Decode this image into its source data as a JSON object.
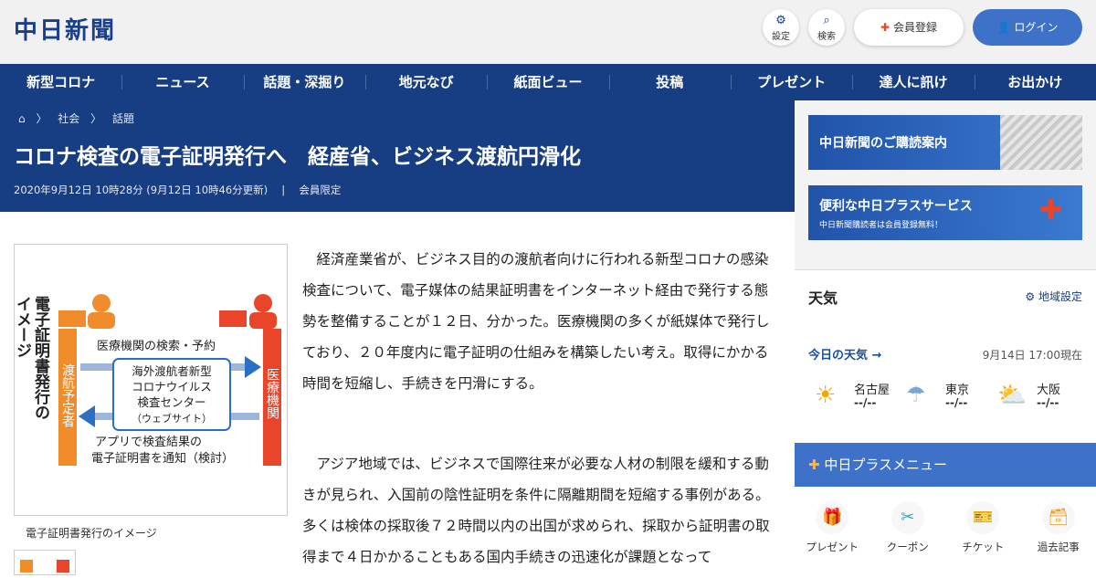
{
  "header": {
    "logo": "中日新聞",
    "settings_label": "設定",
    "search_label": "検索",
    "register_label": "会員登録",
    "login_label": "ログイン"
  },
  "nav": {
    "items": [
      "新型コロナ",
      "ニュース",
      "話題・深掘り",
      "地元なび",
      "紙面ビュー",
      "投稿",
      "プレゼント",
      "達人に訊け",
      "お出かけ"
    ]
  },
  "breadcrumb": {
    "items": [
      "社会",
      "話題"
    ]
  },
  "article": {
    "title": "コロナ検査の電子証明発行へ　経産省、ビジネス渡航円滑化",
    "date": "2020年9月12日 10時28分 (9月12日 10時46分更新)",
    "members_only": "会員限定",
    "caption": "電子証明書発行のイメージ",
    "paragraphs": [
      "経済産業省が、ビジネス目的の渡航者向けに行われる新型コロナの感染検査について、電子媒体の結果証明書をインターネット経由で発行する態勢を整備することが１２日、分かった。医療機関の多くが紙媒体で発行しており、２０年度内に電子証明の仕組みを構築したい考え。取得にかかる時間を短縮し、手続きを円滑にする。",
      "アジア地域では、ビジネスで国際往来が必要な人材の制限を緩和する動きが見られ、入国前の陰性証明を条件に隔離期間を短縮する事例がある。多くは検体の採取後７２時間以内の出国が求められ、採取から証明書の取得まで４日かかることもある国内手続きの迅速化が課題となって"
    ]
  },
  "figure": {
    "vertical_title": [
      "電子証明書発行の",
      "イメージ"
    ],
    "left_actor": "渡航予定者",
    "right_actor": "医療機関",
    "top_arrow_label": "医療機関の検索・予約",
    "center_box": [
      "海外渡航者新型",
      "コロナウイルス",
      "検査センター",
      "（ウェブサイト）"
    ],
    "bottom_label": [
      "アプリで検査結果の",
      "電子証明書を通知（検討）"
    ],
    "accent_orange": "#f08c2a",
    "accent_red": "#e8452a",
    "accent_blue": "#2a6fc4"
  },
  "sidebar": {
    "ad1": "中日新聞のご購読案内",
    "ad2_title": "便利な中日プラスサービス",
    "ad2_sub": "中日新聞購読者は会員登録無料！",
    "weather_title": "天気",
    "region_setting": "地域設定",
    "today_weather": "今日の天気",
    "updated": "9月14日 17:00現在",
    "cities": [
      {
        "name": "名古屋",
        "temp": "--/--",
        "icon": "sun-icon"
      },
      {
        "name": "東京",
        "temp": "--/--",
        "icon": "cloud-rain-icon"
      },
      {
        "name": "大阪",
        "temp": "--/--",
        "icon": "sun-cloud-icon"
      }
    ],
    "plus_menu_title": "中日プラスメニュー",
    "plus_menu": [
      "プレゼント",
      "クーポン",
      "チケット",
      "過去記事"
    ]
  },
  "colors": {
    "brand_navy": "#173d82",
    "brand_blue": "#3e71c8"
  }
}
